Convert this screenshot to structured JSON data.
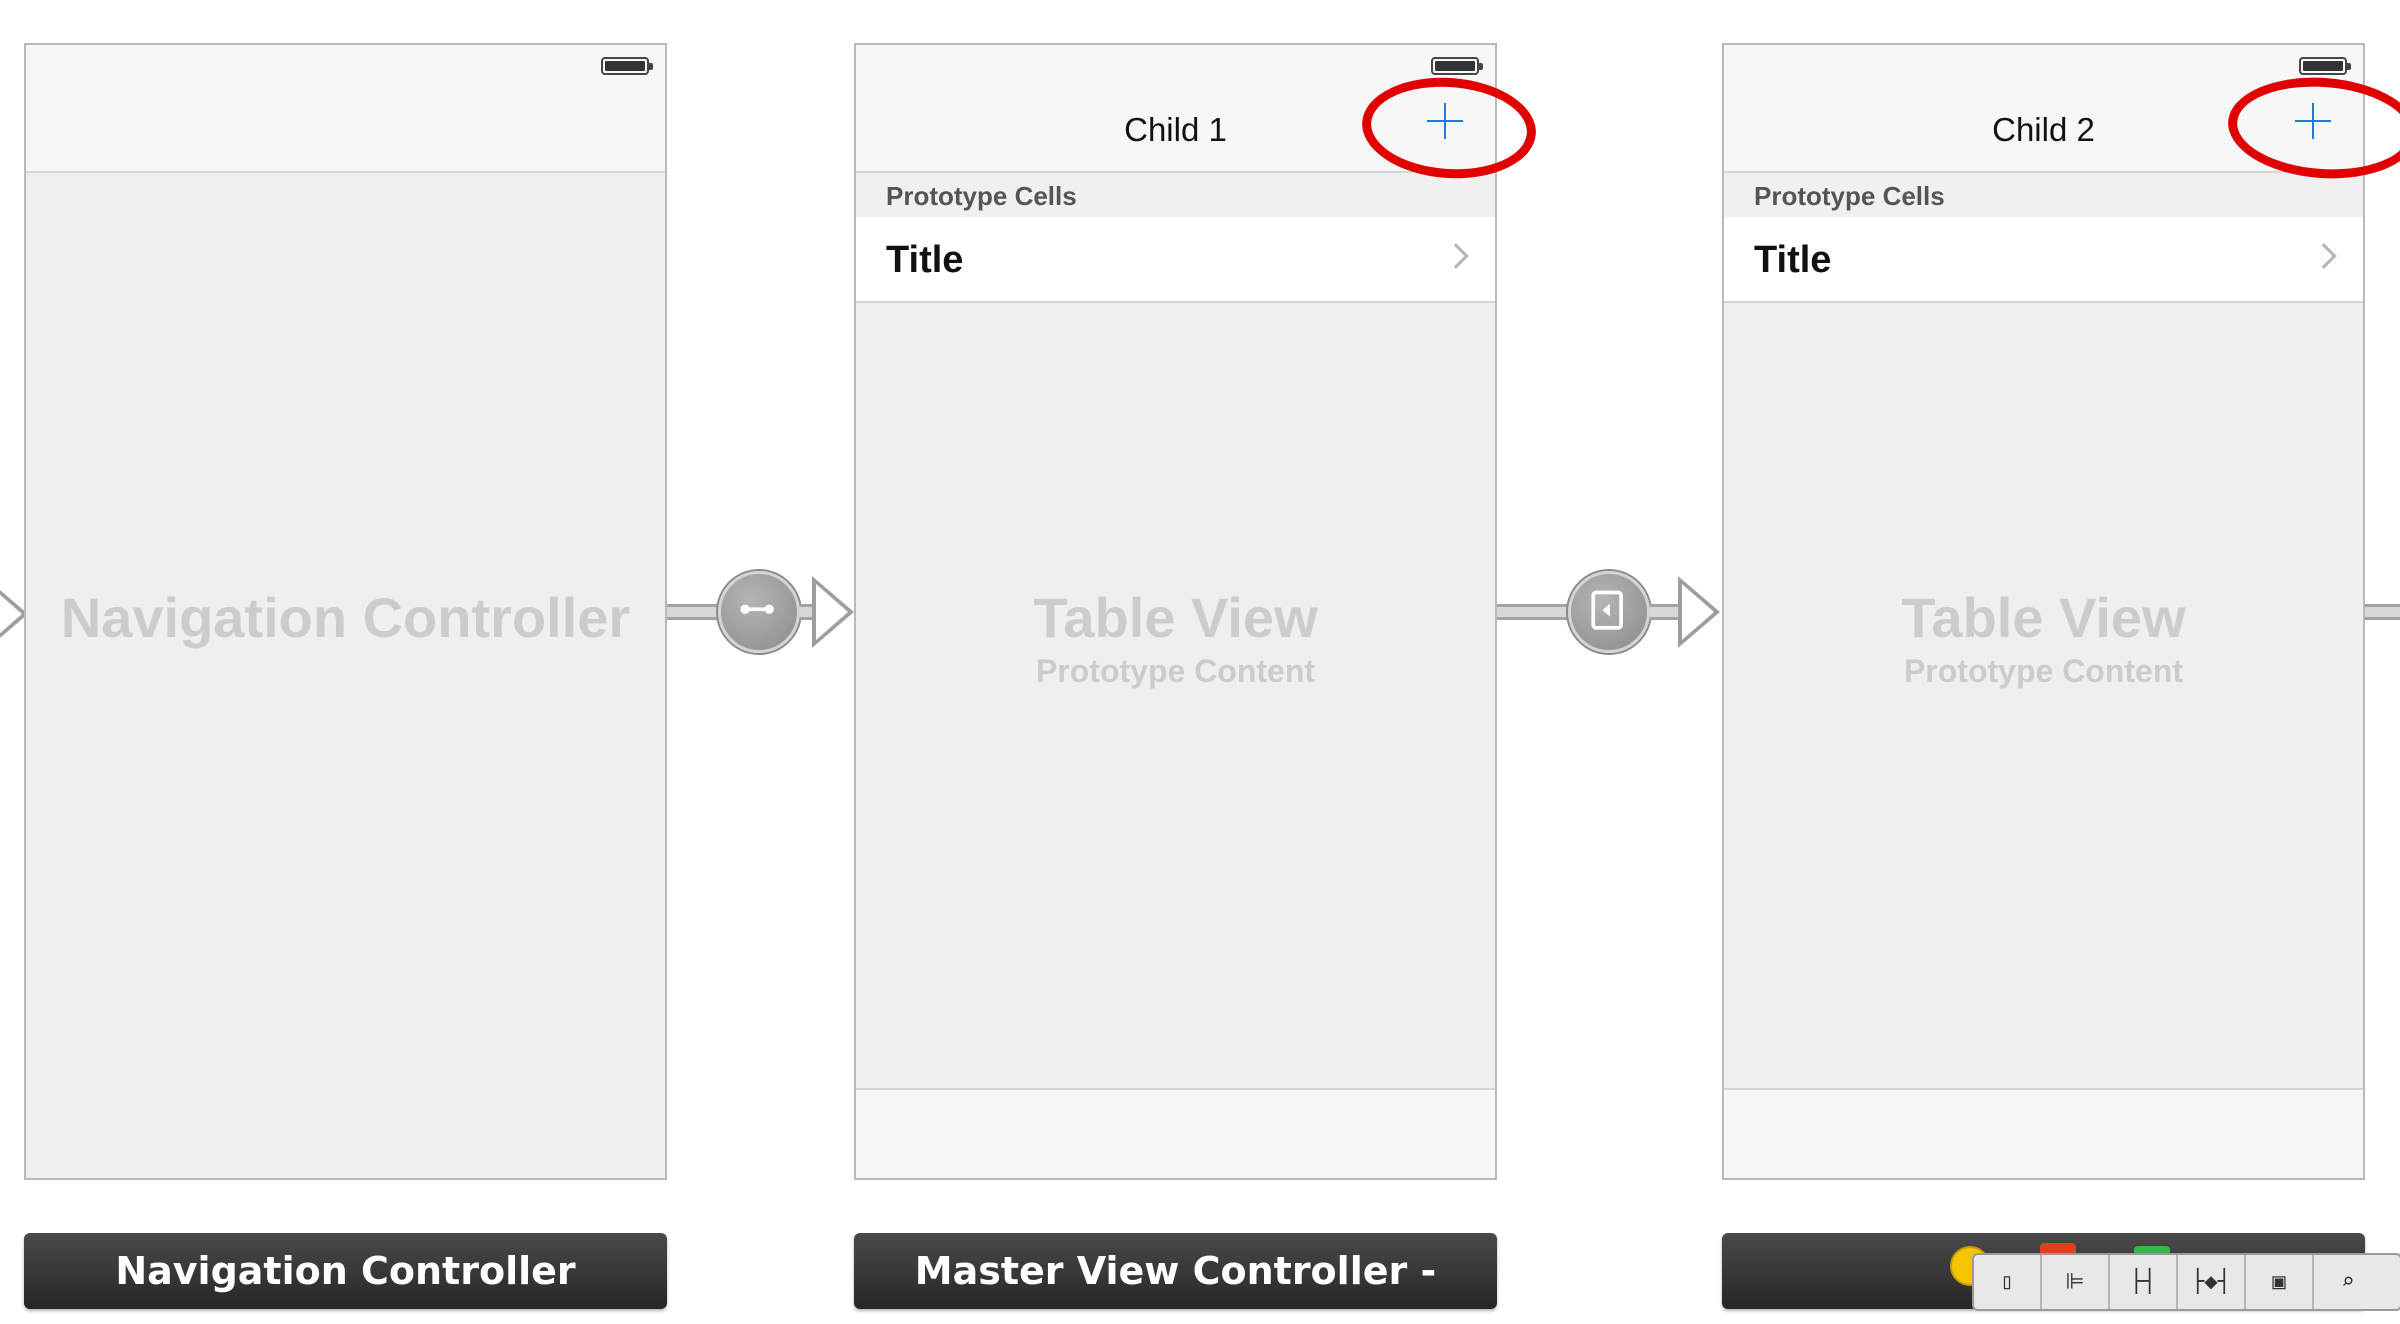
{
  "scenes": [
    {
      "ghost_title": "Navigation Controller",
      "label": "Navigation Controller"
    },
    {
      "nav_title": "Child 1",
      "section_header": "Prototype Cells",
      "cell_title": "Title",
      "ghost_title": "Table View",
      "ghost_subtitle": "Prototype Content",
      "label": "Master View Controller - Master"
    },
    {
      "nav_title": "Child 2",
      "section_header": "Prototype Cells",
      "cell_title": "Title",
      "ghost_title": "Table View",
      "ghost_subtitle": "Prototype Content",
      "label": ""
    }
  ],
  "segues": [
    {
      "icon": "relationship-segue-icon"
    },
    {
      "icon": "push-segue-icon"
    }
  ],
  "toolbar": {
    "icons": [
      "device-icon",
      "align-icon",
      "pin-icon",
      "resolve-icon",
      "resize-icon",
      "zoom-icon"
    ]
  },
  "colors": {
    "accent": "#1f78e8",
    "highlight": "#e00000",
    "label_bar": "#333333",
    "ghost_text": "#cccccc"
  }
}
